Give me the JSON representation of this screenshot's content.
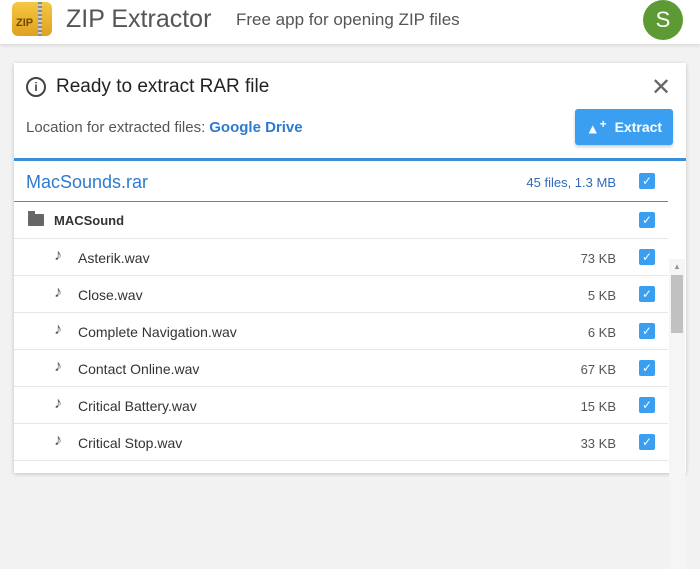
{
  "app": {
    "logo_text": "ZIP",
    "title": "ZIP Extractor",
    "tagline": "Free app for opening ZIP files",
    "avatar": "S"
  },
  "dialog": {
    "title": "Ready to extract RAR file",
    "location_label": "Location for extracted files:",
    "location_value": "Google Drive",
    "extract_label": "Extract"
  },
  "archive": {
    "name": "MacSounds.rar",
    "summary": "45 files, 1.3 MB"
  },
  "folder": {
    "name": "MACSound"
  },
  "files": [
    {
      "name": "Asterik.wav",
      "size": "73 KB"
    },
    {
      "name": "Close.wav",
      "size": "5 KB"
    },
    {
      "name": "Complete Navigation.wav",
      "size": "6 KB"
    },
    {
      "name": "Contact Online.wav",
      "size": "67 KB"
    },
    {
      "name": "Critical Battery.wav",
      "size": "15 KB"
    },
    {
      "name": "Critical Stop.wav",
      "size": "33 KB"
    }
  ]
}
